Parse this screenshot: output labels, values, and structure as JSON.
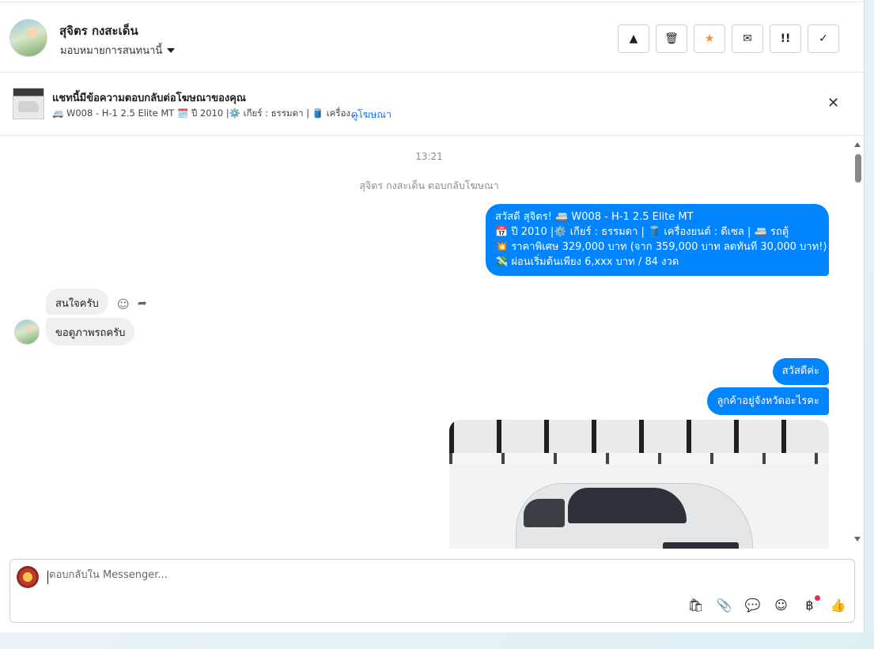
{
  "header": {
    "contact_name": "สุจิตร กงสะเด็น",
    "assign_label": "มอบหมายการสนทนานี้",
    "buttons": [
      {
        "icon": "warning-icon",
        "glyph": "▲"
      },
      {
        "icon": "trash-icon",
        "glyph": "🗑"
      },
      {
        "icon": "star-icon",
        "glyph": "★"
      },
      {
        "icon": "envelope-icon",
        "glyph": "✉"
      },
      {
        "icon": "exclamation-icon",
        "glyph": "!!"
      },
      {
        "icon": "check-icon",
        "glyph": "✓"
      }
    ]
  },
  "ad_banner": {
    "title": "แชทนี้มีข้อความตอบกลับต่อโฆษณาของคุณ",
    "subtitle": "🚐 W008 - H-1 2.5 Elite MT 🗓️ ปี 2010 |⚙️ เกียร์ : ธรรมดา | 🛢️ เครื่อง...",
    "link": "ดูโฆษณา",
    "close_glyph": "✕"
  },
  "chat": {
    "timestamp": "13:21",
    "system_message": "สุจิตร กงสะเด็น ตอบกลับโฆษณา",
    "outgoing_ad_lines": [
      "สวัสดี สุจิตร! 🚐 W008 - H-1 2.5 Elite MT",
      "📅 ปี 2010 |⚙️ เกียร์ : ธรรมดา | 🛢️ เครื่องยนต์ : ดีเซล | 🚐 รถตู้",
      "💥 ราคาพิเศษ 329,000 บาท (จาก 359,000 บาท ลดทันที 30,000 บาท!)",
      "💸 ผ่อนเริ่มต้นเพียง 6,xxx บาท / 84 งวด"
    ],
    "incoming": [
      {
        "text": "สนใจครับ"
      },
      {
        "text": "ขอดูภาพรถครับ"
      }
    ],
    "outgoing_short": [
      {
        "text": "สวัสดีค่ะ"
      },
      {
        "text": "ลูกค้าอยู่จังหวัดอะไรคะ"
      }
    ],
    "reaction_glyph": "☺",
    "reply_glyph": "➦"
  },
  "composer": {
    "placeholder": "ตอบกลับใน Messenger...",
    "tools": [
      {
        "icon": "shopping-bag-icon",
        "glyph": "🛍"
      },
      {
        "icon": "paperclip-icon",
        "glyph": "📎"
      },
      {
        "icon": "chat-bubble-icon",
        "glyph": "💬"
      },
      {
        "icon": "emoji-icon",
        "glyph": "☺"
      },
      {
        "icon": "baht-icon",
        "glyph": "฿"
      },
      {
        "icon": "thumbs-up-icon",
        "glyph": "👍"
      }
    ]
  },
  "colors": {
    "accent": "#0084ff",
    "link": "#1877f2",
    "star": "#f7923a",
    "notification_dot": "#f02849"
  }
}
